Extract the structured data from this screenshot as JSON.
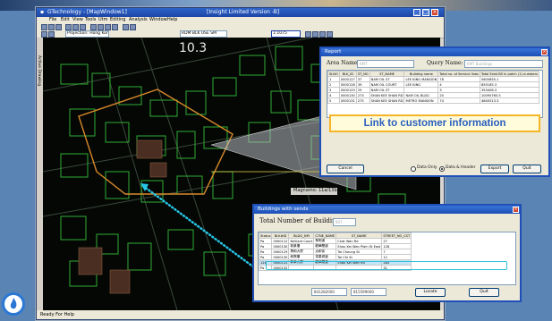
{
  "app": {
    "title": "GTechnology - [MapWindow1]",
    "title_mid": "[Insight Limited Version -B]",
    "menu": [
      "File",
      "Edit",
      "View",
      "Tools",
      "Utm",
      "Editing",
      "Analysis",
      "Window",
      "Help"
    ],
    "projection_combo": "Projection: Hong Kong",
    "layer_combo": "RDM BLK USE SM",
    "zoom_combo": "1:1075",
    "ruler_label": "Active Drawing",
    "status": "Ready For Help",
    "map_text_large": "10.3",
    "map_text_tag": "Magnamo: 11a/13b"
  },
  "report": {
    "title": "Report",
    "area_label": "Area Name:",
    "area_value": "KMT",
    "query_label": "Query Name:",
    "query_value": "KMT Buildings",
    "columns": [
      "SLNO",
      "BLK_ID",
      "ST_NO",
      "ST_NAME",
      "Building name",
      "Total no. of Service lines",
      "Total Exist BS in patch (1) numbers"
    ],
    "rows": [
      [
        "1",
        "0000127",
        "37",
        "NAM OIL ST",
        "LEE KING MANSION",
        "78",
        "5605855.1"
      ],
      [
        "2",
        "0000128",
        "39",
        "NAM OIL COURT",
        "LEE KING",
        "4",
        "855185.3"
      ],
      [
        "3",
        "0000129",
        "29",
        "NAM OIL ST",
        "",
        "3",
        "353406.3"
      ],
      [
        "4",
        "0000130",
        "273",
        "SHAN KEE SHAN RD",
        "NAM OIL BLDG",
        "20",
        "10095765.5"
      ],
      [
        "5",
        "0000131",
        "275",
        "SHAN KEE SHAN RD",
        "METRO MANSION",
        "74",
        "4840513.3"
      ]
    ],
    "cancel_label": "Cancel",
    "radio_data_only": "Data Only",
    "radio_data_header": "Data & Header",
    "export_label": "Export",
    "quit_label": "Quit"
  },
  "callout": {
    "text": "Link to customer information"
  },
  "buildings": {
    "title": "Buildings with sends",
    "total_label": "Total Number of Buildings:",
    "total_value": "807",
    "columns": [
      "Status",
      "BLK#ID",
      "BLDG_NM",
      "CTNE_NAME",
      "ST_NAME",
      "STREET_NO_CST"
    ],
    "rows": [
      [
        "Pa",
        "0000112",
        "Brilliant Court",
        "黎明道",
        "Chat Wan Rd",
        "27"
      ],
      [
        "Pa",
        "0000130",
        "新景樓",
        "龍華閣道",
        "Shau Kei Wan Plain St East",
        "128"
      ],
      [
        "Pa",
        "0000129",
        "興和大廈",
        "太和街",
        "Tai Cheung St",
        "7"
      ],
      [
        "Pa",
        "0000130",
        "和興樓",
        "茶果嶺道",
        "Tai Chi St",
        "12"
      ],
      [
        "128",
        "0000131",
        "新華大廈",
        "龍華閣道",
        "Shau Kei Wan Rd",
        "283"
      ],
      [
        "Pa",
        "0000132",
        "",
        "",
        "",
        "31"
      ]
    ],
    "highlight_row": 4,
    "coord_x": "841282000",
    "coord_y": "815599000",
    "locate_label": "Locate",
    "quit_label": "Quit"
  },
  "colors": {
    "title_blue": "#1c4fb6",
    "callout_border": "#f5b526",
    "callout_text": "#2a5fbf",
    "boundary_orange": "#d98a2b",
    "connector_cyan": "#27c6e6",
    "selection_cyan": "#2ec0d8"
  }
}
